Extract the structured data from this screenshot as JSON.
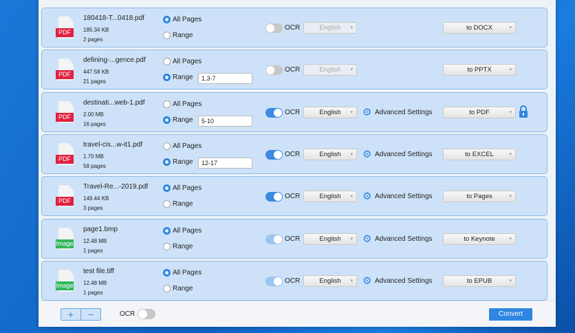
{
  "files": [
    {
      "name": "180418-T...0418.pdf",
      "size": "185.34 KB",
      "pages": "2 pages",
      "type": "PDF",
      "mode": "all",
      "range": "",
      "ocr": "off",
      "language": "English",
      "format": "to DOCX",
      "advanced": false,
      "lock": false
    },
    {
      "name": "defining-...gence.pdf",
      "size": "447.58 KB",
      "pages": "21 pages",
      "type": "PDF",
      "mode": "range",
      "range": "1,3-7",
      "ocr": "off",
      "language": "English",
      "format": "to PPTX",
      "advanced": false,
      "lock": false
    },
    {
      "name": "destinati...web-1.pdf",
      "size": "2.00 MB",
      "pages": "16 pages",
      "type": "PDF",
      "mode": "range",
      "range": "5-10",
      "ocr": "on",
      "language": "English",
      "format": "to PDF",
      "advanced": true,
      "lock": true
    },
    {
      "name": "travel-cis...w-it1.pdf",
      "size": "1.70 MB",
      "pages": "58 pages",
      "type": "PDF",
      "mode": "range",
      "range": "12-17",
      "ocr": "on",
      "language": "English",
      "format": "to EXCEL",
      "advanced": true,
      "lock": false
    },
    {
      "name": "Travel-Re...-2019.pdf",
      "size": "149.44 KB",
      "pages": "3 pages",
      "type": "PDF",
      "mode": "all",
      "range": "",
      "ocr": "on",
      "language": "English",
      "format": "to Pages",
      "advanced": true,
      "lock": false
    },
    {
      "name": "page1.bmp",
      "size": "12.48 MB",
      "pages": "1 pages",
      "type": "Image",
      "mode": "all",
      "range": "",
      "ocr": "dim",
      "language": "English",
      "format": "to Keynote",
      "advanced": true,
      "lock": false
    },
    {
      "name": "test file.tiff",
      "size": "12.48 MB",
      "pages": "1 pages",
      "type": "Image",
      "mode": "all",
      "range": "",
      "ocr": "dim",
      "language": "English",
      "format": "to EPUB",
      "advanced": true,
      "lock": false
    }
  ],
  "labels": {
    "all_pages": "All Pages",
    "range": "Range",
    "ocr": "OCR",
    "advanced": "Advanced Settings"
  },
  "bottom": {
    "add": "+",
    "remove": "−",
    "ocr_label": "OCR",
    "convert": "Convert"
  },
  "colors": {
    "pdf_tag": "#e0213f",
    "image_tag": "#2fb85a",
    "accent": "#2e86e0"
  }
}
